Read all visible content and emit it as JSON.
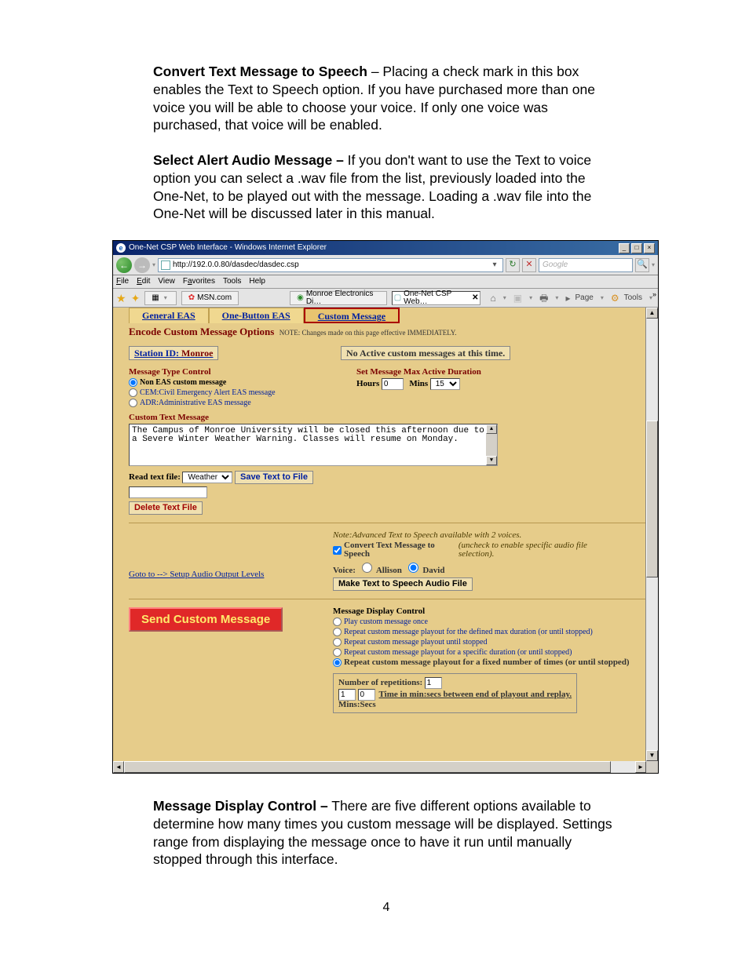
{
  "doc": {
    "p1_b": "Convert Text Message to Speech",
    "p1_r": " – Placing a check mark in this box enables the Text to Speech option.  If you have purchased more than one voice you will be able to choose your voice.  If only one voice was purchased, that voice will be enabled.",
    "p2_b": "Select Alert Audio Message –",
    "p2_r": " If you don't want to use the Text to voice option you can select a .wav file from the list, previously loaded into the One-Net, to be played out with the message.  Loading a .wav file into the One-Net will be discussed later in this manual.",
    "p3_b": "Message Display Control –",
    "p3_r": " There are five different options available to determine how many times you custom message will be displayed.  Settings range from displaying the message once to have it run until manually stopped through this interface.",
    "pagenum": "4"
  },
  "win": {
    "title": "One-Net CSP Web Interface - Windows Internet Explorer",
    "min": "_",
    "max": "□",
    "close": "×",
    "url": "http://192.0.0.80/dasdec/dasdec.csp",
    "go": "→",
    "stop": "✕",
    "search_ph": "Google",
    "mag": "🔍",
    "menu": {
      "file": "File",
      "edit": "Edit",
      "view": "View",
      "fav": "Favorites",
      "tools": "Tools",
      "help": "Help"
    },
    "tab_msn": "MSN.com",
    "tab_mon": "Monroe Electronics Di…",
    "tab_one": "One-Net CSP Web…",
    "tool_page": "Page",
    "tool_tools": "Tools",
    "overflow": "»"
  },
  "eas": {
    "tab_gen": "General EAS",
    "tab_one": "One-Button EAS",
    "tab_cust": "Custom Message",
    "heading": "Encode Custom Message Options",
    "heading_note": "NOTE: Changes made on this page effective IMMEDIATELY.",
    "station_lbl": "Station ID:",
    "station_val": "Monroe",
    "noactive": "No Active custom messages at this time.",
    "msgtype_hdr": "Message Type Control",
    "opt_non": "Non EAS custom message",
    "opt_cem": "CEM:Civil Emergency Alert EAS message",
    "opt_adr": "ADR:Administrative EAS message",
    "duration_hdr": "Set Message Max Active Duration",
    "hours_lbl": "Hours",
    "hours_val": "0",
    "mins_lbl": "Mins",
    "mins_val": "15",
    "custtext_hdr": "Custom Text Message",
    "textarea": "The Campus of Monroe University will be closed this afternoon due to a Severe Winter Weather Warning.  Classes will resume on Monday.",
    "readfile_lbl": "Read text file:",
    "readfile_val": "Weather",
    "save_btn": "Save Text to File",
    "del_btn": "Delete Text File",
    "tts_note": "Note:Advanced Text to Speech available with 2 voices.",
    "tts_chk": "Convert Text Message to Speech",
    "tts_chk2": "(uncheck to enable specific audio file selection).",
    "voice_lbl": "Voice:",
    "voice_a": "Allison",
    "voice_d": "David",
    "make_btn": "Make Text to Speech Audio File",
    "goto": "Goto to --> Setup Audio Output Levels",
    "send_btn": "Send Custom Message",
    "mdc_hdr": "Message Display Control",
    "mdc_1": "Play custom message once",
    "mdc_2": "Repeat custom message playout for the defined max duration (or until stopped)",
    "mdc_3": "Repeat custom message playout until stopped",
    "mdc_4": "Repeat custom message playout for a specific duration (or until stopped)",
    "mdc_5": "Repeat custom message playout for a fixed number of times (or until stopped)",
    "numreps_lbl": "Number of repetitions:",
    "numreps_val": "1",
    "tmin_val": "1",
    "tsec_val": "0",
    "time_lbl": "Time in min:secs between end of playout and replay.",
    "minsec": "Mins:Secs"
  }
}
